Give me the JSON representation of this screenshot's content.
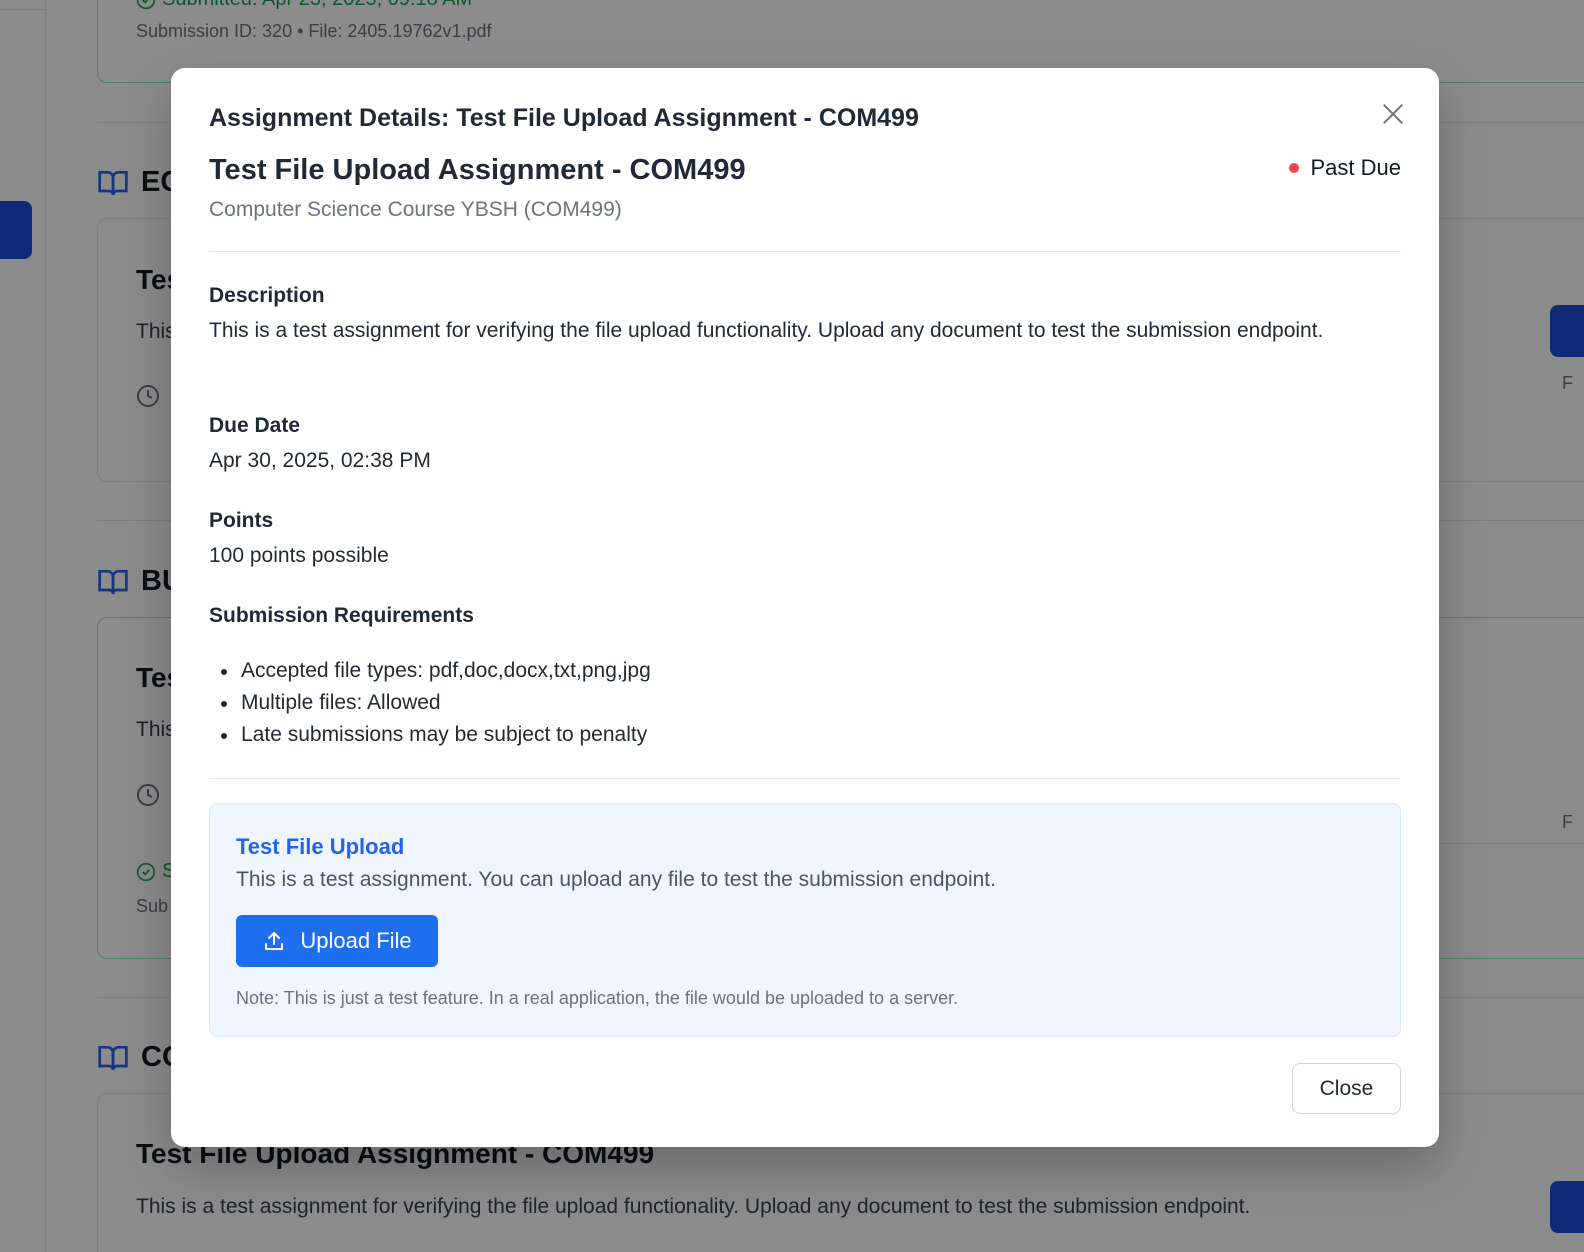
{
  "background": {
    "top_card": {
      "submitted": "Submitted: Apr 23, 2025, 09:18 AM",
      "meta": "Submission ID: 320 • File: 2405.19762v1.pdf"
    },
    "sections": [
      {
        "label": "EC"
      },
      {
        "label": "BU"
      },
      {
        "label": "CO"
      }
    ],
    "cards": [
      {
        "title": "Tes",
        "text": "This",
        "due": "I"
      },
      {
        "title": "Tes",
        "text": "This",
        "due": "I",
        "submitted": "S",
        "meta": "Sub"
      }
    ],
    "bottom_card": {
      "title": "Test File Upload Assignment - COM499",
      "text": "This is a test assignment for verifying the file upload functionality. Upload any document to test the submission endpoint."
    },
    "right_edge": [
      "F",
      "F"
    ]
  },
  "modal": {
    "header_title": "Assignment Details: Test File Upload Assignment - COM499",
    "assignment_title": "Test File Upload Assignment - COM499",
    "course": "Computer Science Course YBSH (COM499)",
    "status": "Past Due",
    "description_label": "Description",
    "description": "This is a test assignment for verifying the file upload functionality. Upload any document to test the submission endpoint.",
    "due_label": "Due Date",
    "due_value": "Apr 30, 2025, 02:38 PM",
    "points_label": "Points",
    "points_value": "100 points possible",
    "requirements_label": "Submission Requirements",
    "requirements": [
      "Accepted file types: pdf,doc,docx,txt,png,jpg",
      "Multiple files: Allowed",
      "Late submissions may be subject to penalty"
    ],
    "upload": {
      "title": "Test File Upload",
      "description": "This is a test assignment. You can upload any file to test the submission endpoint.",
      "button_label": "Upload File",
      "note": "Note: This is just a test feature. In a real application, the file would be uploaded to a server."
    },
    "close_label": "Close"
  },
  "colors": {
    "accent": "#1d6fef",
    "status_past_due": "#ef4444",
    "upload_bg": "#eff6ff",
    "upload_title": "#2563eb"
  },
  "icons": [
    "close-icon",
    "book-icon",
    "clock-icon",
    "check-circle-icon",
    "upload-icon"
  ]
}
